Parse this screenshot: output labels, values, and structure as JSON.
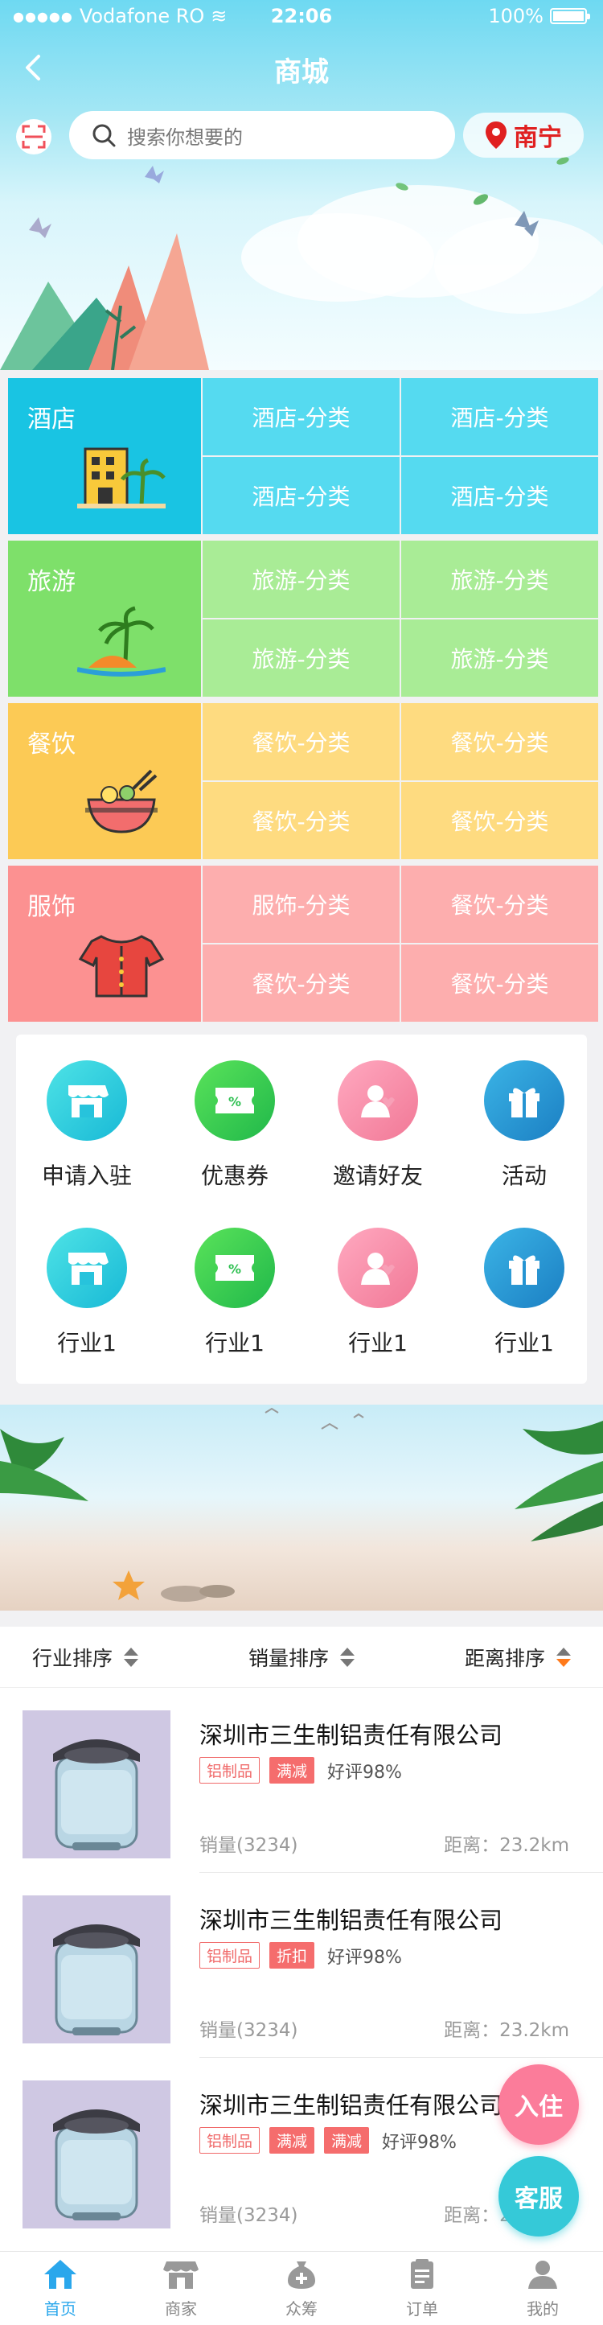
{
  "status": {
    "carrier": "Vodafone RO",
    "time": "22:06",
    "battery": "100%"
  },
  "nav": {
    "title": "商城"
  },
  "search": {
    "placeholder": "搜索你想要的",
    "city": "南宁"
  },
  "categories": [
    {
      "name": "酒店",
      "subs": [
        "酒店-分类",
        "酒店-分类",
        "酒店-分类",
        "酒店-分类"
      ],
      "main_color": "#19c4e3",
      "sub_color": "#55daf0"
    },
    {
      "name": "旅游",
      "subs": [
        "旅游-分类",
        "旅游-分类",
        "旅游-分类",
        "旅游-分类"
      ],
      "main_color": "#7ee06a",
      "sub_color": "#a9ec96"
    },
    {
      "name": "餐饮",
      "subs": [
        "餐饮-分类",
        "餐饮-分类",
        "餐饮-分类",
        "餐饮-分类"
      ],
      "main_color": "#fcca55",
      "sub_color": "#fedb80"
    },
    {
      "name": "服饰",
      "subs": [
        "服饰-分类",
        "餐饮-分类",
        "餐饮-分类",
        "餐饮-分类"
      ],
      "main_color": "#fc9191",
      "sub_color": "#fdaeae"
    }
  ],
  "quick": [
    {
      "label": "申请入驻",
      "icon": "shop-icon"
    },
    {
      "label": "优惠券",
      "icon": "coupon-icon"
    },
    {
      "label": "邀请好友",
      "icon": "invite-friend-icon"
    },
    {
      "label": "活动",
      "icon": "gift-icon"
    },
    {
      "label": "行业1",
      "icon": "shop-icon"
    },
    {
      "label": "行业1",
      "icon": "coupon-icon"
    },
    {
      "label": "行业1",
      "icon": "invite-friend-icon"
    },
    {
      "label": "行业1",
      "icon": "gift-icon"
    }
  ],
  "sort": {
    "industry": "行业排序",
    "sales": "销量排序",
    "distance": "距离排序"
  },
  "items": [
    {
      "name": "深圳市三生制铝责任有限公司",
      "tags": [
        "铝制品",
        "满减"
      ],
      "rating": "好评98%",
      "sales": "销量(3234)",
      "distance": "距离：23.2km"
    },
    {
      "name": "深圳市三生制铝责任有限公司",
      "tags": [
        "铝制品",
        "折扣"
      ],
      "rating": "好评98%",
      "sales": "销量(3234)",
      "distance": "距离：23.2km"
    },
    {
      "name": "深圳市三生制铝责任有限公司",
      "tags": [
        "铝制品",
        "满减",
        "满减"
      ],
      "rating": "好评98%",
      "sales": "销量(3234)",
      "distance": "距离：23.2km"
    }
  ],
  "fab": {
    "join": "入住",
    "service": "客服"
  },
  "tabs": [
    {
      "label": "首页",
      "icon": "home-icon"
    },
    {
      "label": "商家",
      "icon": "store-icon"
    },
    {
      "label": "众筹",
      "icon": "crowdfund-icon"
    },
    {
      "label": "订单",
      "icon": "order-icon"
    },
    {
      "label": "我的",
      "icon": "user-icon"
    }
  ],
  "colors": {
    "accent": "#2aa7ec",
    "city_red": "#e02020",
    "tag_red": "#f56d6d"
  }
}
